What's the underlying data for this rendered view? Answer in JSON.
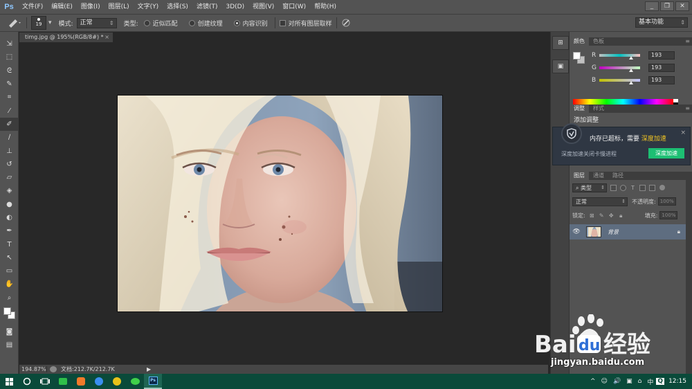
{
  "app": {
    "logo": "Ps"
  },
  "menu": [
    "文件(F)",
    "编辑(E)",
    "图像(I)",
    "图层(L)",
    "文字(Y)",
    "选择(S)",
    "滤镜(T)",
    "3D(D)",
    "视图(V)",
    "窗口(W)",
    "帮助(H)"
  ],
  "window_controls": {
    "minimize": "_",
    "restore": "❐",
    "close": "✕"
  },
  "options": {
    "brush_size": "19",
    "mode_label": "模式:",
    "mode_value": "正常",
    "type_label": "类型:",
    "type_options": [
      "近似匹配",
      "创建纹理",
      "内容识别"
    ],
    "type_selected_index": 2,
    "sample_all_label": "对所有图层取样",
    "workspace": "基本功能"
  },
  "document": {
    "tab_title": "timg.jpg @ 195%(RGB/8#) *",
    "close_glyph": "×",
    "zoom": "194.87%",
    "doc_size": "文档:212.7K/212.7K",
    "status_arrow": "▶"
  },
  "tools": [
    {
      "name": "move-tool-icon",
      "glyph": "⇲"
    },
    {
      "name": "marquee-tool-icon",
      "glyph": "⬚"
    },
    {
      "name": "lasso-tool-icon",
      "glyph": "ᘓ"
    },
    {
      "name": "quick-select-tool-icon",
      "glyph": "✎"
    },
    {
      "name": "crop-tool-icon",
      "glyph": "⌗"
    },
    {
      "name": "eyedropper-tool-icon",
      "glyph": "⁄"
    },
    {
      "name": "spot-healing-tool-icon",
      "glyph": "✐"
    },
    {
      "name": "brush-tool-icon",
      "glyph": "∕"
    },
    {
      "name": "clone-stamp-tool-icon",
      "glyph": "⊥"
    },
    {
      "name": "history-brush-tool-icon",
      "glyph": "↺"
    },
    {
      "name": "eraser-tool-icon",
      "glyph": "▱"
    },
    {
      "name": "paint-bucket-tool-icon",
      "glyph": "◈"
    },
    {
      "name": "blur-tool-icon",
      "glyph": "●"
    },
    {
      "name": "dodge-tool-icon",
      "glyph": "◐"
    },
    {
      "name": "pen-tool-icon",
      "glyph": "✒"
    },
    {
      "name": "type-tool-icon",
      "glyph": "T"
    },
    {
      "name": "path-select-tool-icon",
      "glyph": "↖"
    },
    {
      "name": "rectangle-tool-icon",
      "glyph": "▭"
    },
    {
      "name": "hand-tool-icon",
      "glyph": "✋"
    },
    {
      "name": "zoom-tool-icon",
      "glyph": "⌕"
    }
  ],
  "tool_active_index": 6,
  "color_panel": {
    "tabs": [
      "颜色",
      "色板"
    ],
    "channels": [
      {
        "label": "R",
        "value": "193"
      },
      {
        "label": "G",
        "value": "193"
      },
      {
        "label": "B",
        "value": "193"
      }
    ],
    "foreground": "#ffffff",
    "background": "#c1c1c1"
  },
  "adjust_panel": {
    "tabs": [
      "调整",
      "样式"
    ],
    "title": "添加调整"
  },
  "popup": {
    "title": "内存已超标，需要",
    "title_link": "深度加速",
    "subtitle": "深度加速关闭卡慢进程",
    "button": "深度加速",
    "close": "×",
    "accent": "#1dbf73"
  },
  "layers_panel": {
    "tabs": [
      "图层",
      "通道",
      "路径"
    ],
    "filter_label": "类型",
    "blend_mode": "正常",
    "opacity_label": "不透明度:",
    "opacity_value": "100%",
    "lock_label": "锁定:",
    "fill_label": "填充:",
    "fill_value": "100%",
    "layer_name": "背景"
  },
  "watermark": {
    "url": "jingyan.baidu.com"
  },
  "taskbar": {
    "apps": [
      "start-button-icon",
      "cortana-icon",
      "task-view-icon",
      "app-green-icon",
      "app-orange-icon",
      "app-blue-icon",
      "app-yellow-icon",
      "wechat-icon",
      "photoshop-taskbar-icon"
    ],
    "tray": [
      "^",
      "☺",
      "🔊",
      "▣",
      "⌂",
      "中",
      "Q"
    ],
    "clock": "12:15"
  }
}
